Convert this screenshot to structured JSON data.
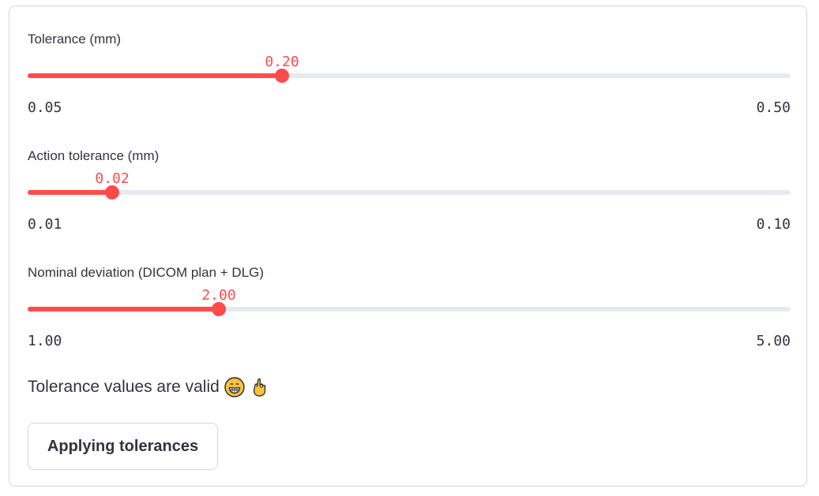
{
  "sliders": [
    {
      "label": "Tolerance (mm)",
      "value": "0.20",
      "min": "0.05",
      "max": "0.50",
      "fraction": 0.3333
    },
    {
      "label": "Action tolerance (mm)",
      "value": "0.02",
      "min": "0.01",
      "max": "0.10",
      "fraction": 0.1111
    },
    {
      "label": "Nominal deviation (DICOM plan + DLG)",
      "value": "2.00",
      "min": "1.00",
      "max": "5.00",
      "fraction": 0.25
    }
  ],
  "status": {
    "text": "Tolerance values are valid",
    "icons": [
      "grinning-face-icon",
      "ok-hand-icon"
    ]
  },
  "apply_button": {
    "label": "Applying tolerances"
  },
  "colors": {
    "accent": "#ff4b4b",
    "track": "#e6e9ef",
    "text": "#31333f",
    "border": "#d6d6d9"
  }
}
